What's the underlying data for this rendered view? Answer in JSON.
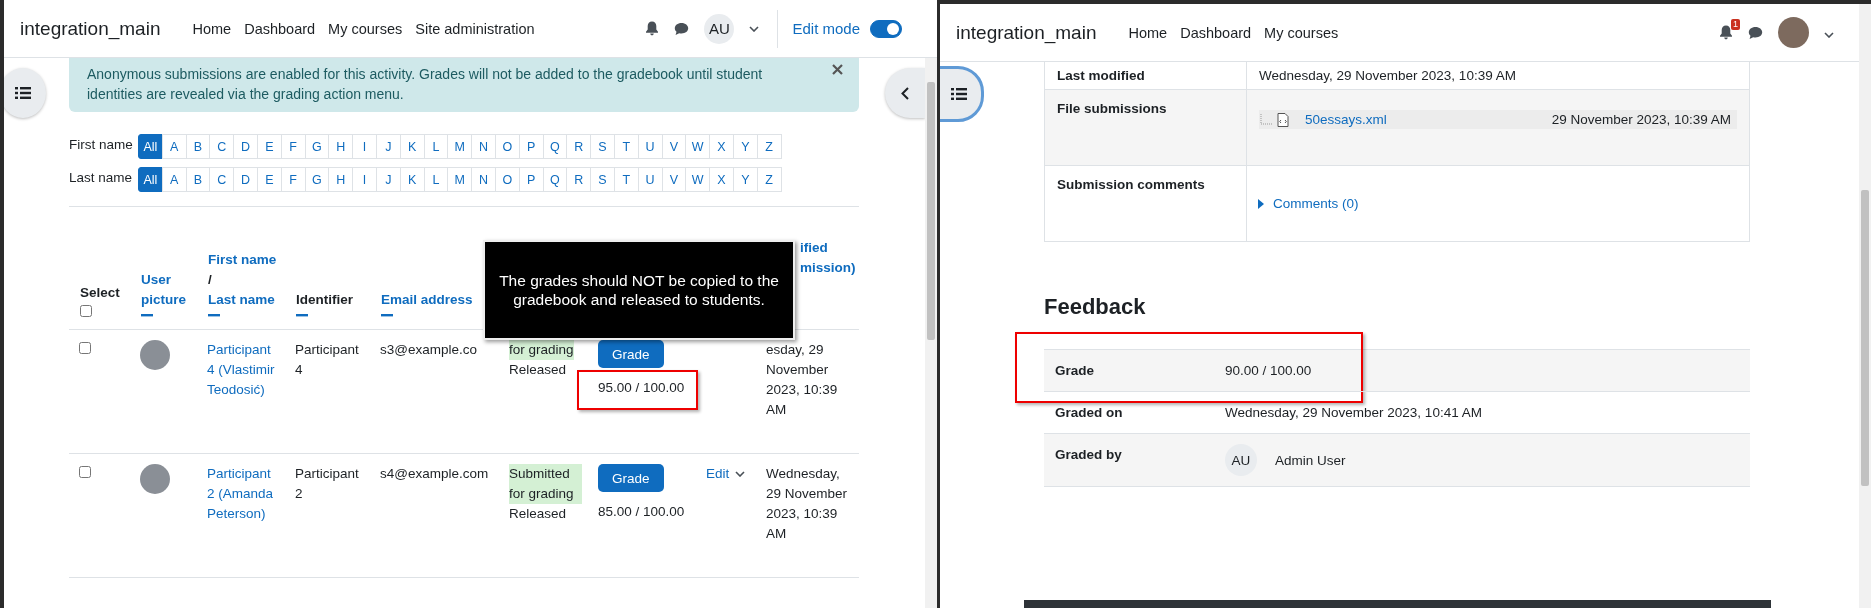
{
  "left_window": {
    "navbar": {
      "site_name": "integration_main",
      "nav": [
        "Home",
        "Dashboard",
        "My courses",
        "Site administration"
      ],
      "user_initials": "AU",
      "edit_mode": {
        "label": "Edit mode",
        "on": true
      }
    },
    "alert": {
      "message": "Anonymous submissions are enabled for this activity. Grades will not be added to the gradebook until student identities are revealed via the grading action menu."
    },
    "filters": [
      {
        "label": "First name",
        "letters": [
          {
            "text": "All",
            "selected": true
          },
          {
            "text": "A",
            "selected": false
          },
          {
            "text": "B",
            "selected": false
          },
          {
            "text": "C",
            "selected": false
          },
          {
            "text": "D",
            "selected": false
          },
          {
            "text": "E",
            "selected": false
          },
          {
            "text": "F",
            "selected": false
          },
          {
            "text": "G",
            "selected": false
          },
          {
            "text": "H",
            "selected": false
          },
          {
            "text": "I",
            "selected": false
          },
          {
            "text": "J",
            "selected": false
          },
          {
            "text": "K",
            "selected": false
          },
          {
            "text": "L",
            "selected": false
          },
          {
            "text": "M",
            "selected": false
          },
          {
            "text": "N",
            "selected": false
          },
          {
            "text": "O",
            "selected": false
          },
          {
            "text": "P",
            "selected": false
          },
          {
            "text": "Q",
            "selected": false
          },
          {
            "text": "R",
            "selected": false
          },
          {
            "text": "S",
            "selected": false
          },
          {
            "text": "T",
            "selected": false
          },
          {
            "text": "U",
            "selected": false
          },
          {
            "text": "V",
            "selected": false
          },
          {
            "text": "W",
            "selected": false
          },
          {
            "text": "X",
            "selected": false
          },
          {
            "text": "Y",
            "selected": false
          },
          {
            "text": "Z",
            "selected": false
          }
        ]
      },
      {
        "label": "Last name",
        "letters": [
          {
            "text": "All",
            "selected": true
          },
          {
            "text": "A",
            "selected": false
          },
          {
            "text": "B",
            "selected": false
          },
          {
            "text": "C",
            "selected": false
          },
          {
            "text": "D",
            "selected": false
          },
          {
            "text": "E",
            "selected": false
          },
          {
            "text": "F",
            "selected": false
          },
          {
            "text": "G",
            "selected": false
          },
          {
            "text": "H",
            "selected": false
          },
          {
            "text": "I",
            "selected": false
          },
          {
            "text": "J",
            "selected": false
          },
          {
            "text": "K",
            "selected": false
          },
          {
            "text": "L",
            "selected": false
          },
          {
            "text": "M",
            "selected": false
          },
          {
            "text": "N",
            "selected": false
          },
          {
            "text": "O",
            "selected": false
          },
          {
            "text": "P",
            "selected": false
          },
          {
            "text": "Q",
            "selected": false
          },
          {
            "text": "R",
            "selected": false
          },
          {
            "text": "S",
            "selected": false
          },
          {
            "text": "T",
            "selected": false
          },
          {
            "text": "U",
            "selected": false
          },
          {
            "text": "V",
            "selected": false
          },
          {
            "text": "W",
            "selected": false
          },
          {
            "text": "X",
            "selected": false
          },
          {
            "text": "Y",
            "selected": false
          },
          {
            "text": "Z",
            "selected": false
          }
        ]
      }
    ],
    "table": {
      "select_all": false,
      "columns": [
        {
          "kind": "select",
          "label": "Select"
        },
        {
          "kind": "link",
          "label": "User picture"
        },
        {
          "kind": "names",
          "first": "First name",
          "separator": "/",
          "last": "Last name"
        },
        {
          "kind": "plain",
          "label": "Identifier"
        },
        {
          "kind": "link",
          "label": "Email address"
        },
        {
          "kind": "covered"
        },
        {
          "kind": "covered"
        },
        {
          "kind": "covered"
        },
        {
          "kind": "partial",
          "lines": [
            "ified",
            "mission)"
          ]
        }
      ],
      "rows": [
        {
          "selected": false,
          "participant": "Participant 4 (Vlastimir Teodosić)",
          "identifier": "Participant 4",
          "email": "s3@example.co",
          "status": "for grading",
          "release": "Released",
          "grade_button": "Grade",
          "grade": "95.00 / 100.00",
          "highlighted": true,
          "modified": "esday, 29 November 2023, 10:39 AM"
        },
        {
          "selected": false,
          "participant": "Participant 2 (Amanda Peterson)",
          "identifier": "Participant 2",
          "email": "s4@example.com",
          "status": "Submitted for grading",
          "release": "Released",
          "grade_button": "Grade",
          "grade": "85.00 / 100.00",
          "highlighted": false,
          "edit": "Edit",
          "modified": "Wednesday, 29 November 2023, 10:39 AM"
        }
      ]
    },
    "tooltip": "The grades should NOT be copied to the gradebook and released to students."
  },
  "right_window": {
    "navbar": {
      "site_name": "integration_main",
      "nav": [
        "Home",
        "Dashboard",
        "My courses"
      ],
      "notification_count": "1"
    },
    "submission": [
      {
        "kind": "text",
        "label": "Last modified",
        "value": "Wednesday, 29 November 2023, 10:39 AM"
      },
      {
        "kind": "file",
        "label": "File submissions",
        "file": "50essays.xml",
        "date": "29 November 2023, 10:39 AM"
      },
      {
        "kind": "comments",
        "label": "Submission comments",
        "link": "Comments (0)",
        "expanded": false
      }
    ],
    "feedback": {
      "title": "Feedback",
      "rows": [
        {
          "kind": "text",
          "label": "Grade",
          "value": "90.00 / 100.00",
          "highlighted": true
        },
        {
          "kind": "text",
          "label": "Graded on",
          "value": "Wednesday, 29 November 2023, 10:41 AM",
          "highlighted": false
        },
        {
          "kind": "user",
          "label": "Graded by",
          "initials": "AU",
          "value": "Admin User",
          "highlighted": false
        }
      ]
    }
  }
}
